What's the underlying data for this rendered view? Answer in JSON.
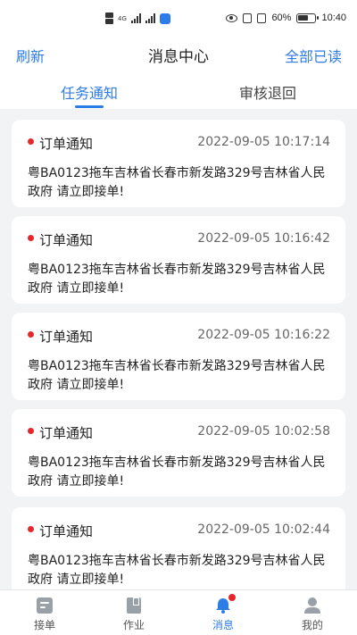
{
  "status_bar": {
    "network_label": "4G",
    "battery_percent": "60%",
    "time": "10:40"
  },
  "header": {
    "left_action": "刷新",
    "title": "消息中心",
    "right_action": "全部已读"
  },
  "tabs": [
    {
      "label": "任务通知",
      "active": true
    },
    {
      "label": "审核退回",
      "active": false
    }
  ],
  "messages": [
    {
      "title": "订单通知",
      "time": "2022-09-05 10:17:14",
      "body": "粤BA0123拖车吉林省长春市新发路329号吉林省人民政府 请立即接单!",
      "unread": true
    },
    {
      "title": "订单通知",
      "time": "2022-09-05 10:16:42",
      "body": "粤BA0123拖车吉林省长春市新发路329号吉林省人民政府 请立即接单!",
      "unread": true
    },
    {
      "title": "订单通知",
      "time": "2022-09-05 10:16:22",
      "body": "粤BA0123拖车吉林省长春市新发路329号吉林省人民政府 请立即接单!",
      "unread": true
    },
    {
      "title": "订单通知",
      "time": "2022-09-05 10:02:58",
      "body": "粤BA0123拖车吉林省长春市新发路329号吉林省人民政府 请立即接单!",
      "unread": true
    },
    {
      "title": "订单通知",
      "time": "2022-09-05 10:02:44",
      "body": "粤BA0123拖车吉林省长春市新发路329号吉林省人民政府 请立即接单!",
      "unread": true
    }
  ],
  "tabbar": {
    "items": [
      {
        "label": "接单",
        "icon": "order-icon"
      },
      {
        "label": "作业",
        "icon": "task-icon"
      },
      {
        "label": "消息",
        "icon": "bell-icon",
        "active": true,
        "badge": true
      },
      {
        "label": "我的",
        "icon": "profile-icon"
      }
    ]
  },
  "colors": {
    "accent": "#2e7ce6",
    "unread_dot": "#e8262a",
    "background": "#f2f3f5"
  }
}
